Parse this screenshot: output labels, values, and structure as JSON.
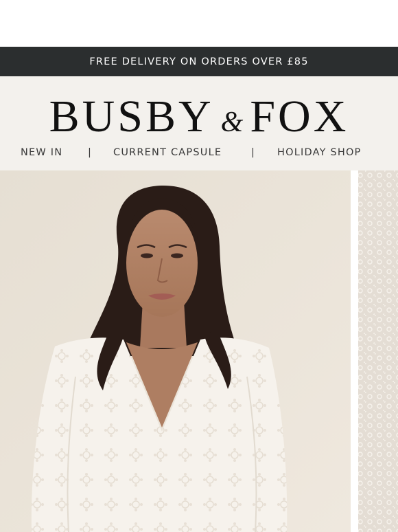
{
  "promo": {
    "text": "FREE DELIVERY ON ORDERS OVER £85"
  },
  "brand": {
    "part1": "BUSBY",
    "amp": "&",
    "part2": "FOX"
  },
  "nav": {
    "items": [
      {
        "label": "NEW IN"
      },
      {
        "label": "CURRENT CAPSULE"
      },
      {
        "label": "HOLIDAY SHOP"
      }
    ],
    "separator": "|"
  },
  "colors": {
    "promo_bg": "#2b2e2f",
    "header_bg": "#f3f1ed",
    "hero_bg": "#e9e2d8"
  }
}
